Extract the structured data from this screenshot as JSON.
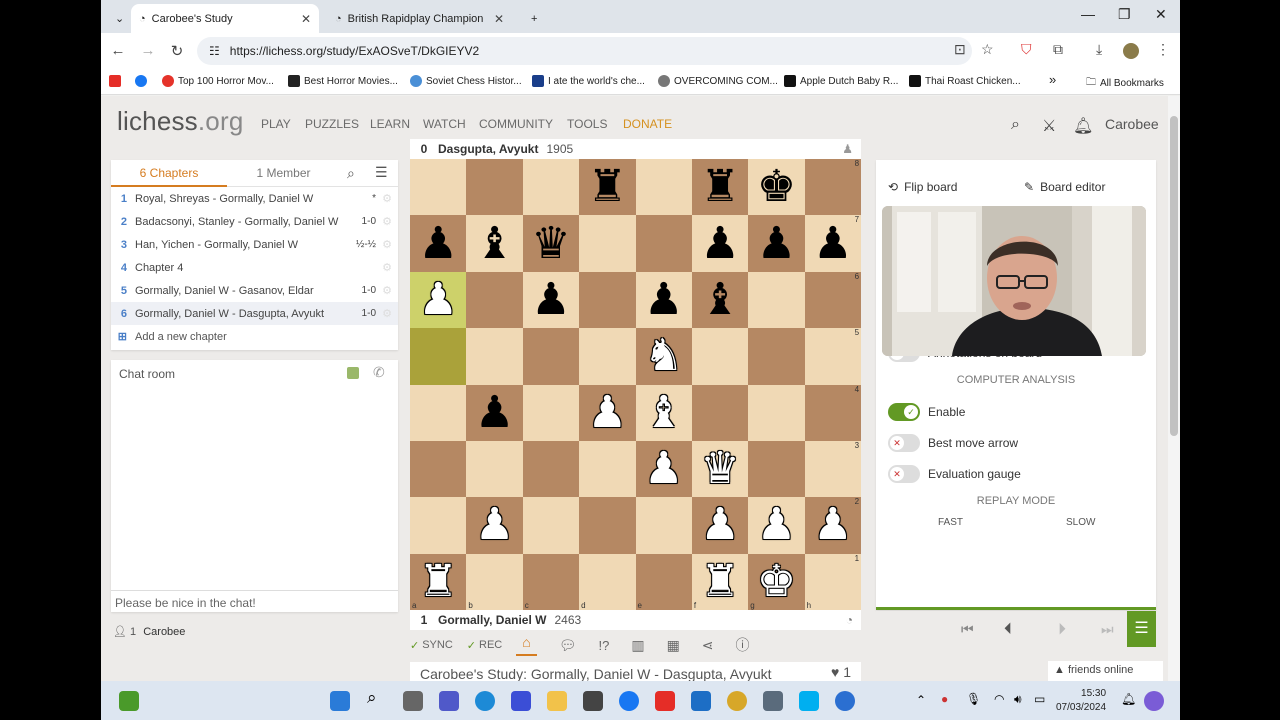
{
  "browser": {
    "tabs": [
      {
        "title": "Carobee's Study"
      },
      {
        "title": "British Rapidplay Championship"
      }
    ],
    "new_tab": "+",
    "url": "https://lichess.org/study/ExAOSveT/DkGIEYV2",
    "bookmarks": [
      {
        "label": "Top 100 Horror Mov...",
        "color": "#e5332a"
      },
      {
        "label": "Best Horror Movies...",
        "color": "#222"
      },
      {
        "label": "Soviet Chess Histor...",
        "color": "#4a8fd6"
      },
      {
        "label": "I ate the world's che...",
        "color": "#1a3e8a"
      },
      {
        "label": "OVERCOMING COM...",
        "color": "#666"
      },
      {
        "label": "Apple Dutch Baby R...",
        "color": "#111"
      },
      {
        "label": "Thai Roast Chicken...",
        "color": "#111"
      }
    ],
    "all_bookmarks": "All Bookmarks",
    "more_bookmarks": "»"
  },
  "site": {
    "logo_main": "lichess",
    "logo_suffix": ".org",
    "nav": [
      "PLAY",
      "PUZZLES",
      "LEARN",
      "WATCH",
      "COMMUNITY",
      "TOOLS",
      "DONATE"
    ],
    "username": "Carobee"
  },
  "study": {
    "tab_chapters": "6 Chapters",
    "tab_members": "1 Member",
    "chapters": [
      {
        "num": "1",
        "name": "Royal, Shreyas - Gormally, Daniel W",
        "result": "*"
      },
      {
        "num": "2",
        "name": "Badacsonyi, Stanley - Gormally, Daniel W",
        "result": "1-0"
      },
      {
        "num": "3",
        "name": "Han, Yichen - Gormally, Daniel W",
        "result": "½-½"
      },
      {
        "num": "4",
        "name": "Chapter 4",
        "result": ""
      },
      {
        "num": "5",
        "name": "Gormally, Daniel W - Gasanov, Eldar",
        "result": "1-0"
      },
      {
        "num": "6",
        "name": "Gormally, Daniel W - Dasgupta, Avyukt",
        "result": "1-0"
      }
    ],
    "add_chapter": "Add a new chapter",
    "chat_title": "Chat room",
    "chat_placeholder": "Please be nice in the chat!",
    "members_count": "1",
    "member_name": "Carobee",
    "title": "Carobee's Study: Gormally, Daniel W - Dasgupta, Avyukt",
    "likes": "1"
  },
  "game": {
    "top_player": {
      "num": "0",
      "name": "Dasgupta, Avyukt",
      "rating": "1905"
    },
    "bottom_player": {
      "num": "1",
      "name": "Gormally, Daniel W",
      "rating": "2463"
    },
    "files": [
      "a",
      "b",
      "c",
      "d",
      "e",
      "f",
      "g",
      "h"
    ],
    "ranks": [
      "8",
      "7",
      "6",
      "5",
      "4",
      "3",
      "2",
      "1"
    ],
    "position": [
      "...r.rk.",
      "pbq..ppp",
      "P.p.pb..",
      "....N...",
      ".p.PB...",
      "....PQ..",
      ".P...PPP",
      "R....RK."
    ],
    "last_move": [
      "a6",
      "a5"
    ],
    "tools": {
      "sync": "SYNC",
      "rec": "REC"
    }
  },
  "analysis_panel": {
    "flip_board": "Flip board",
    "board_editor": "Board editor",
    "annotations_label": "Annotations on board",
    "computer_analysis": "COMPUTER ANALYSIS",
    "toggles": [
      {
        "label": "Enable",
        "on": true
      },
      {
        "label": "Best move arrow",
        "on": false
      },
      {
        "label": "Evaluation gauge",
        "on": false
      }
    ],
    "replay_mode": "REPLAY MODE",
    "fast": "FAST",
    "slow": "SLOW"
  },
  "friends": "friends online",
  "taskbar": {
    "time": "15:30",
    "date": "07/03/2024"
  }
}
